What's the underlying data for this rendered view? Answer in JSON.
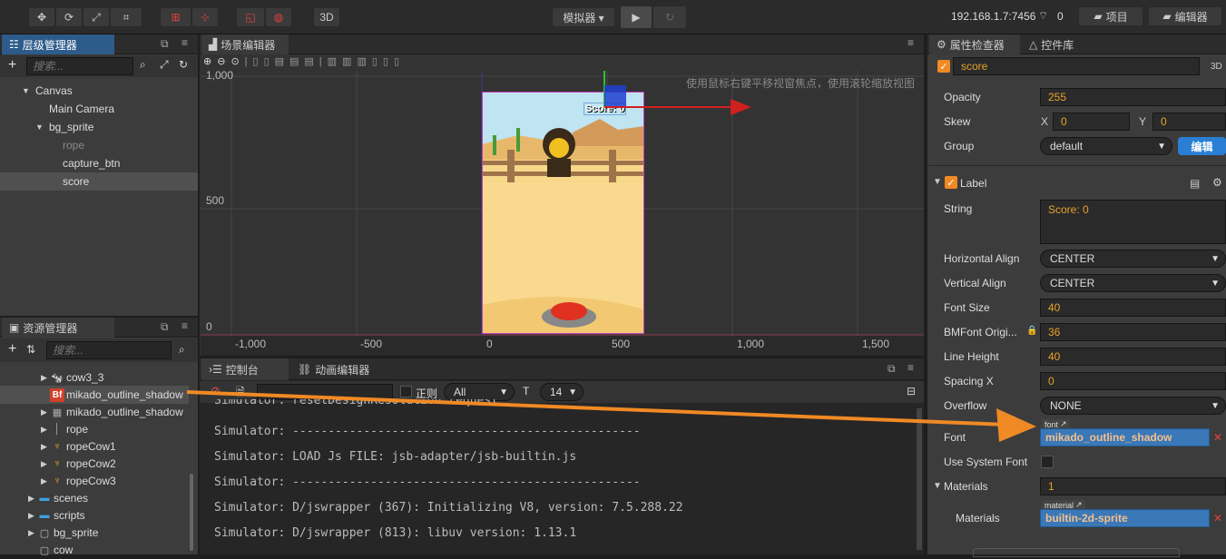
{
  "toolbar": {
    "simulator_label": "模拟器 ▾",
    "mode_3d": "3D",
    "ip": "192.168.1.7:7456",
    "wifi_count": "0",
    "project_btn": "项目",
    "editor_btn": "编辑器"
  },
  "hierarchy": {
    "title": "层级管理器",
    "search_placeholder": "搜索...",
    "nodes": [
      {
        "label": "Canvas",
        "depth": 0,
        "expanded": true
      },
      {
        "label": "Main Camera",
        "depth": 1
      },
      {
        "label": "bg_sprite",
        "depth": 1,
        "expanded": true
      },
      {
        "label": "rope",
        "depth": 2,
        "dim": true
      },
      {
        "label": "capture_btn",
        "depth": 2
      },
      {
        "label": "score",
        "depth": 2,
        "selected": true
      }
    ]
  },
  "assets": {
    "title": "资源管理器",
    "search_placeholder": "搜索...",
    "items": [
      {
        "label": "cow3_3"
      },
      {
        "label": "mikado_outline_shadow",
        "selected": true
      },
      {
        "label": "mikado_outline_shadow"
      },
      {
        "label": "rope"
      },
      {
        "label": "ropeCow1"
      },
      {
        "label": "ropeCow2"
      },
      {
        "label": "ropeCow3"
      },
      {
        "label": "scenes"
      },
      {
        "label": "scripts"
      },
      {
        "label": "bg_sprite"
      },
      {
        "label": "cow"
      }
    ]
  },
  "scene": {
    "title": "场景编辑器",
    "hint": "使用鼠标右键平移视窗焦点，使用滚轮缩放视图",
    "y_ticks": [
      "1,000",
      "500",
      "0"
    ],
    "x_ticks": [
      "-1,000",
      "-500",
      "0",
      "500",
      "1,000",
      "1,500"
    ],
    "score_text": "Score: 0"
  },
  "console": {
    "title": "控制台",
    "anim_title": "动画编辑器",
    "regex_label": "正则",
    "filter_value": "All",
    "font_size": "14",
    "lines": [
      "Simulator: resetDesignResolution request",
      "Simulator: -------------------------------------------------",
      "Simulator: LOAD Js FILE: jsb-adapter/jsb-builtin.js",
      "Simulator: -------------------------------------------------",
      "Simulator: D/jswrapper (367): Initializing V8, version: 7.5.288.22",
      "Simulator: D/jswrapper (813): libuv version: 1.13.1"
    ]
  },
  "inspector": {
    "title": "属性检查器",
    "controls_title": "控件库",
    "node_name": "score",
    "badge_3d": "3D",
    "opacity_label": "Opacity",
    "opacity": "255",
    "skew_label": "Skew",
    "skew_x_label": "X",
    "skew_x": "0",
    "skew_y_label": "Y",
    "skew_y": "0",
    "group_label": "Group",
    "group": "default",
    "edit_btn": "编辑",
    "component": "Label",
    "string_label": "String",
    "string": "Score: 0",
    "halign_label": "Horizontal Align",
    "halign": "CENTER",
    "valign_label": "Vertical Align",
    "valign": "CENTER",
    "fontsize_label": "Font Size",
    "fontsize": "40",
    "bmfont_label": "BMFont Origi...",
    "bmfont": "36",
    "lineheight_label": "Line Height",
    "lineheight": "40",
    "spacingx_label": "Spacing X",
    "spacingx": "0",
    "overflow_label": "Overflow",
    "overflow": "NONE",
    "font_label": "Font",
    "font_tag": "font",
    "font": "mikado_outline_shadow",
    "sysfont_label": "Use System Font",
    "materials_label": "Materials",
    "materials_count": "1",
    "materials_item_label": "Materials",
    "material_tag": "material",
    "material": "builtin-2d-sprite"
  },
  "colors": {
    "accent_orange": "#f08a24",
    "selection_blue": "#2f6ea8",
    "value_orange": "#e8a22a"
  }
}
